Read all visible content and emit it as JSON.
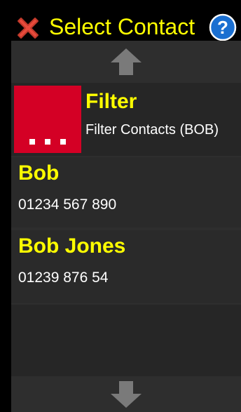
{
  "header": {
    "title": "Select Contact",
    "close_icon": "close-x-icon",
    "help_icon": "help-question-icon"
  },
  "colors": {
    "title": "#ffff00",
    "background": "#000000",
    "panel": "#2e2e2e",
    "filter_tile": "#d40025",
    "arrow": "#7a7a7a"
  },
  "filter": {
    "title": "Filter",
    "subtitle": "Filter Contacts (BOB)",
    "icon": "ellipsis-icon"
  },
  "contacts": [
    {
      "name": "Bob",
      "phone": "01234 567 890"
    },
    {
      "name": "Bob Jones",
      "phone": "01239 876 54"
    }
  ],
  "scroll": {
    "up_icon": "arrow-up-icon",
    "down_icon": "arrow-down-icon"
  }
}
